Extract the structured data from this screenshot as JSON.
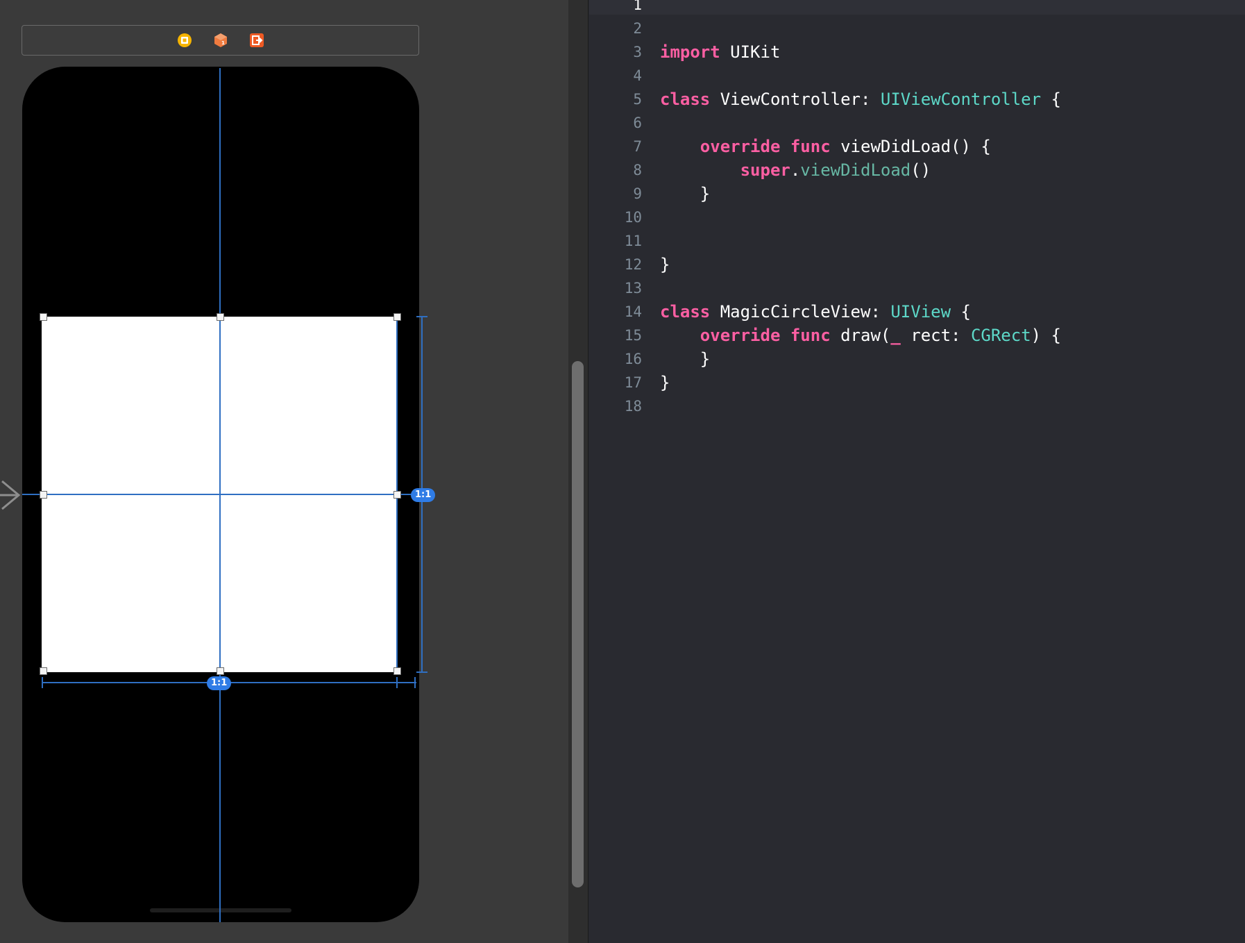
{
  "colors": {
    "canvas_background": "#3a3a3a",
    "editor_background": "#292a30",
    "keyword": "#fc5fa3",
    "type": "#5dd8c8",
    "function_call": "#67b7a4",
    "constraint_line": "#2f6fc2",
    "badge": "#2f7ce6"
  },
  "interface_builder": {
    "scene_dock": {
      "icons": [
        "view-controller-icon",
        "first-responder-icon",
        "exit-icon"
      ]
    },
    "entry_point": "entry-point-arrow-icon",
    "constraints": {
      "height_ratio_badge": "1:1",
      "width_ratio_badge": "1:1"
    }
  },
  "editor": {
    "current_line": 1,
    "lines": [
      {
        "n": "1",
        "tokens": []
      },
      {
        "n": "2",
        "tokens": []
      },
      {
        "n": "3",
        "tokens": [
          {
            "t": "import",
            "c": "kw"
          },
          {
            "t": " UIKit",
            "c": ""
          }
        ]
      },
      {
        "n": "4",
        "tokens": []
      },
      {
        "n": "5",
        "tokens": [
          {
            "t": "class",
            "c": "kw"
          },
          {
            "t": " ViewController: ",
            "c": ""
          },
          {
            "t": "UIViewController",
            "c": "ty"
          },
          {
            "t": " {",
            "c": ""
          }
        ]
      },
      {
        "n": "6",
        "tokens": []
      },
      {
        "n": "7",
        "tokens": [
          {
            "t": "    ",
            "c": ""
          },
          {
            "t": "override",
            "c": "kw"
          },
          {
            "t": " ",
            "c": ""
          },
          {
            "t": "func",
            "c": "kw"
          },
          {
            "t": " viewDidLoad() {",
            "c": ""
          }
        ]
      },
      {
        "n": "8",
        "tokens": [
          {
            "t": "        ",
            "c": ""
          },
          {
            "t": "super",
            "c": "kw"
          },
          {
            "t": ".",
            "c": ""
          },
          {
            "t": "viewDidLoad",
            "c": "fn"
          },
          {
            "t": "()",
            "c": ""
          }
        ]
      },
      {
        "n": "9",
        "tokens": [
          {
            "t": "    }",
            "c": ""
          }
        ]
      },
      {
        "n": "10",
        "tokens": []
      },
      {
        "n": "11",
        "tokens": []
      },
      {
        "n": "12",
        "tokens": [
          {
            "t": "}",
            "c": ""
          }
        ]
      },
      {
        "n": "13",
        "tokens": []
      },
      {
        "n": "14",
        "tokens": [
          {
            "t": "class",
            "c": "kw"
          },
          {
            "t": " MagicCircleView: ",
            "c": ""
          },
          {
            "t": "UIView",
            "c": "ty"
          },
          {
            "t": " {",
            "c": ""
          }
        ]
      },
      {
        "n": "15",
        "tokens": [
          {
            "t": "    ",
            "c": ""
          },
          {
            "t": "override",
            "c": "kw"
          },
          {
            "t": " ",
            "c": ""
          },
          {
            "t": "func",
            "c": "kw"
          },
          {
            "t": " draw(",
            "c": ""
          },
          {
            "t": "_",
            "c": "kw"
          },
          {
            "t": " rect: ",
            "c": ""
          },
          {
            "t": "CGRect",
            "c": "ty"
          },
          {
            "t": ") {",
            "c": ""
          }
        ]
      },
      {
        "n": "16",
        "tokens": [
          {
            "t": "    }",
            "c": ""
          }
        ]
      },
      {
        "n": "17",
        "tokens": [
          {
            "t": "}",
            "c": ""
          }
        ]
      },
      {
        "n": "18",
        "tokens": []
      }
    ]
  }
}
